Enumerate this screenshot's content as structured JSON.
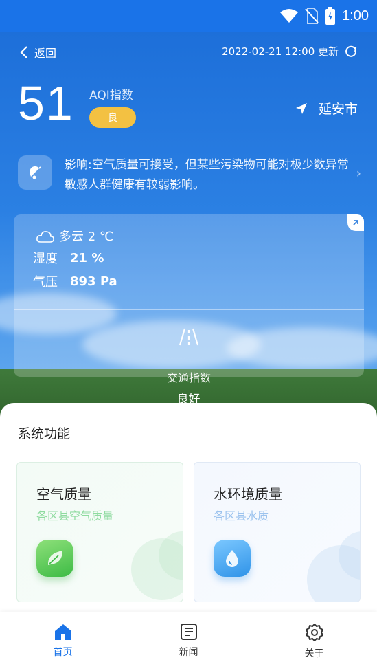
{
  "status_bar": {
    "time": "1:00",
    "icons": [
      "wifi-icon",
      "no-sim-icon",
      "battery-charging-icon"
    ]
  },
  "header": {
    "back_label": "返回",
    "update_text": "2022-02-21 12:00 更新",
    "refresh_icon": "refresh-icon"
  },
  "aqi": {
    "value": "51",
    "label": "AQI指数",
    "level": "良",
    "level_color": "#f3c142"
  },
  "location": {
    "city": "延安市",
    "icon": "location-arrow-icon"
  },
  "impact": {
    "text": "影响:空气质量可接受，但某些污染物可能对极少数异常敏感人群健康有较弱影响。",
    "icon": "bell-icon"
  },
  "weather": {
    "condition": "多云 2 ℃",
    "humidity_label": "湿度",
    "humidity_value": "21 %",
    "pressure_label": "气压",
    "pressure_value": "893 Pa",
    "traffic_label": "交通指数",
    "traffic_value": "良好"
  },
  "section": {
    "title": "系统功能"
  },
  "features": [
    {
      "title": "空气质量",
      "subtitle": "各区县空气质量",
      "icon": "leaf-icon"
    },
    {
      "title": "水环境质量",
      "subtitle": "各区县水质",
      "icon": "water-drop-icon"
    }
  ],
  "nav": [
    {
      "label": "首页",
      "icon": "home-icon",
      "active": true
    },
    {
      "label": "新闻",
      "icon": "news-icon",
      "active": false
    },
    {
      "label": "关于",
      "icon": "settings-icon",
      "active": false
    }
  ],
  "colors": {
    "primary": "#1a73e8",
    "air_green": "#3dbb45",
    "water_blue": "#2f93e8"
  }
}
